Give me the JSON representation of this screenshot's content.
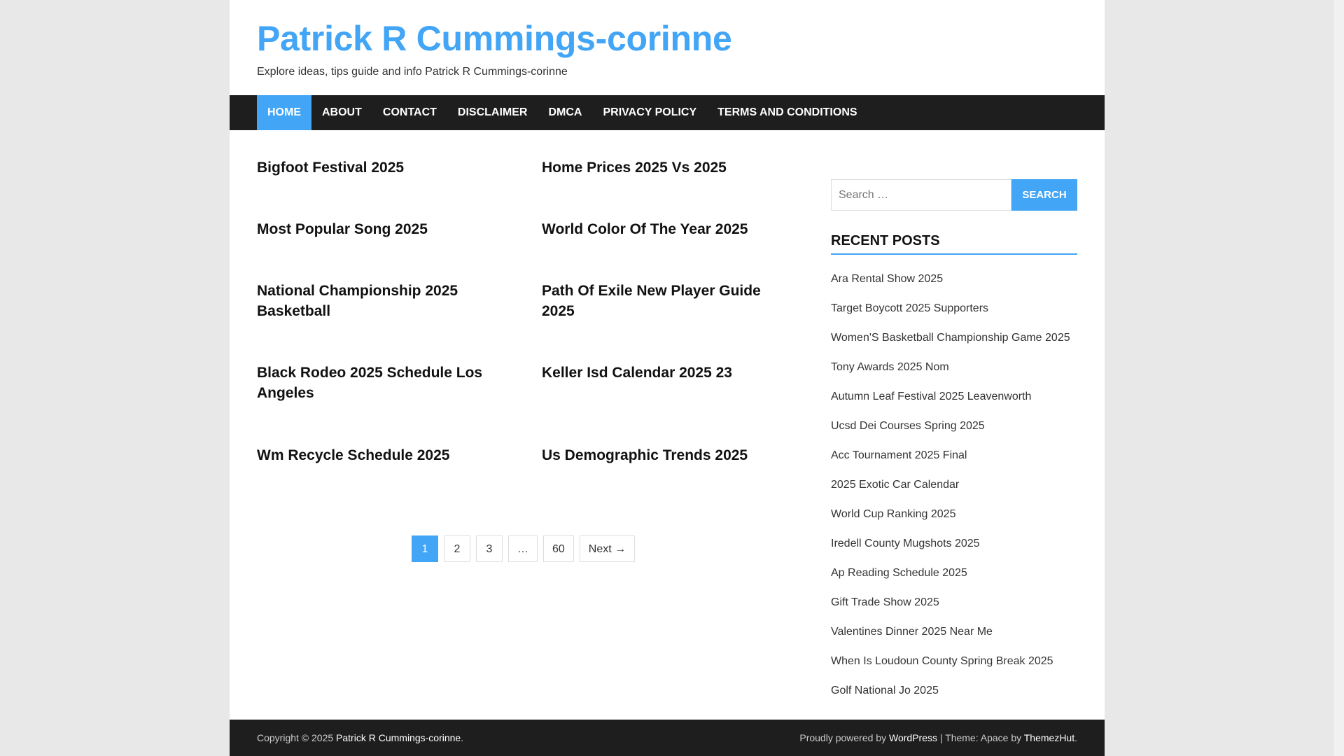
{
  "site": {
    "title": "Patrick R Cummings-corinne",
    "description": "Explore ideas, tips guide and info Patrick R Cummings-corinne"
  },
  "nav": {
    "items": [
      "HOME",
      "ABOUT",
      "CONTACT",
      "DISCLAIMER",
      "DMCA",
      "PRIVACY POLICY",
      "TERMS AND CONDITIONS"
    ],
    "active": "HOME"
  },
  "posts": [
    "Bigfoot Festival 2025",
    "Home Prices 2025 Vs 2025",
    "Most Popular Song 2025",
    "World Color Of The Year 2025",
    "National Championship 2025 Basketball",
    "Path Of Exile New Player Guide 2025",
    "Black Rodeo 2025 Schedule Los Angeles",
    "Keller Isd Calendar 2025 23",
    "Wm Recycle Schedule 2025",
    "Us Demographic Trends 2025"
  ],
  "pagination": {
    "pages": [
      "1",
      "2",
      "3",
      "…",
      "60"
    ],
    "current": "1",
    "next": "Next →"
  },
  "sidebar": {
    "search": {
      "placeholder": "Search …",
      "button": "SEARCH"
    },
    "recent_title": "RECENT POSTS",
    "recent_posts": [
      "Ara Rental Show 2025",
      "Target Boycott 2025 Supporters",
      "Women'S Basketball Championship Game 2025",
      "Tony Awards 2025 Nom",
      "Autumn Leaf Festival 2025 Leavenworth",
      "Ucsd Dei Courses Spring 2025",
      "Acc Tournament 2025 Final",
      "2025 Exotic Car Calendar",
      "World Cup Ranking 2025",
      "Iredell County Mugshots 2025",
      "Ap Reading Schedule 2025",
      "Gift Trade Show 2025",
      "Valentines Dinner 2025 Near Me",
      "When Is Loudoun County Spring Break 2025",
      "Golf National Jo 2025"
    ]
  },
  "footer": {
    "copyright_prefix": "Copyright © 2025 ",
    "site_link": "Patrick R Cummings-corinne",
    "copyright_suffix": ".",
    "powered_prefix": "Proudly powered by ",
    "wordpress_link": "WordPress",
    "theme_text": " | Theme: Apace by ",
    "themezhut_link": "ThemezHut",
    "theme_suffix": "."
  },
  "colors": {
    "accent": "#42a5f5",
    "nav_bg": "#1e1e1e"
  }
}
